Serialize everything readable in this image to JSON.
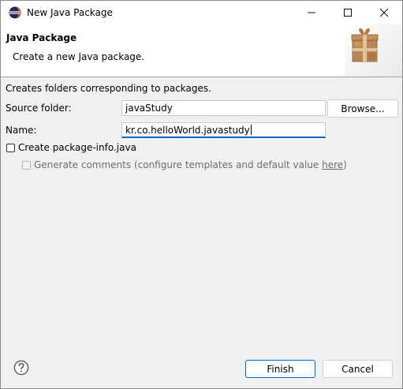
{
  "window": {
    "title": "New Java Package"
  },
  "banner": {
    "title": "Java Package",
    "description": "Create a new Java package."
  },
  "form": {
    "info": "Creates folders corresponding to packages.",
    "source_folder_label": "Source folder:",
    "source_folder_value": "javaStudy",
    "browse_label": "Browse...",
    "name_label": "Name:",
    "name_value": "kr.co.helloWorld.javastudy",
    "create_package_info_label": "Create package-info.java",
    "create_package_info_checked": false,
    "generate_comments_label": "Generate comments",
    "configure_text_prefix": "(configure templates and default value",
    "configure_link": "here",
    "configure_text_suffix": ")",
    "generate_comments_checked": false,
    "generate_comments_enabled": false
  },
  "footer": {
    "finish_label": "Finish",
    "cancel_label": "Cancel"
  },
  "icons": {
    "app": "eclipse-icon",
    "banner": "package-gift-icon",
    "help": "help-icon",
    "minimize": "minimize-icon",
    "maximize": "maximize-icon",
    "close": "close-icon"
  },
  "colors": {
    "accent": "#0067c0",
    "background": "#f0f0f0",
    "banner_background": "#ffffff",
    "package_icon_brown": "#a0703c"
  }
}
